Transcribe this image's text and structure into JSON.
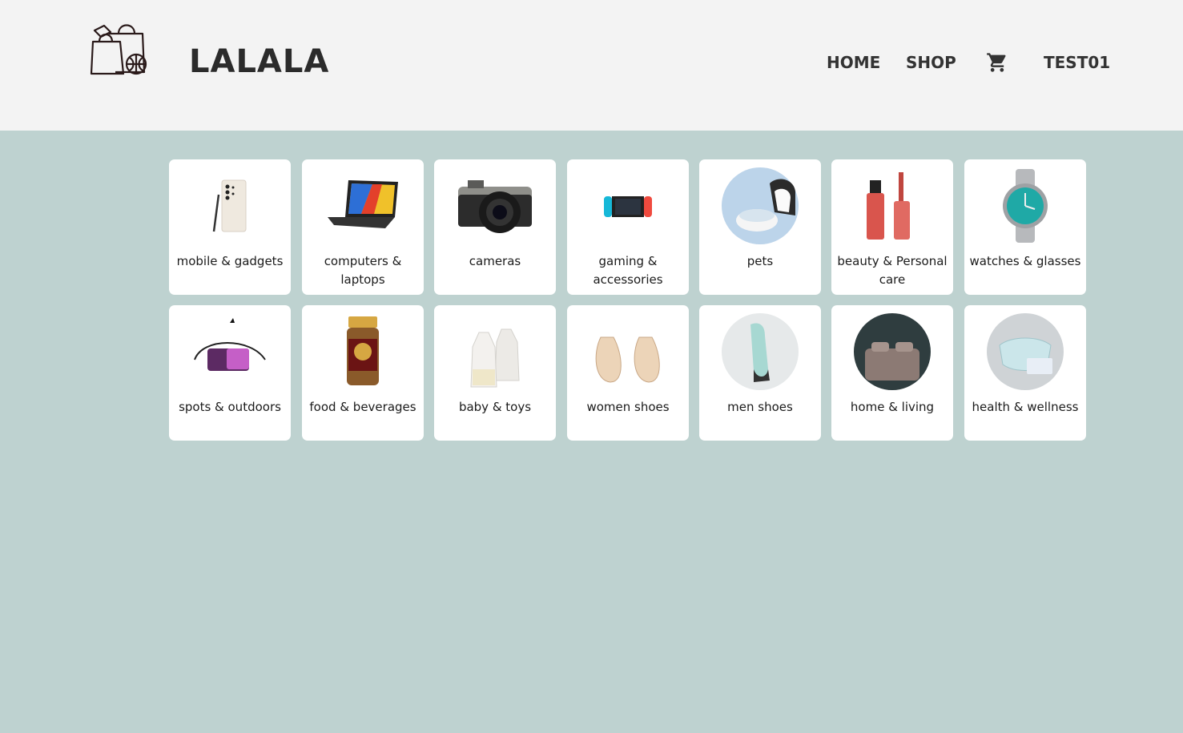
{
  "header": {
    "brand": "LALALA",
    "logo_icon": "shopping-bags-globe-icon",
    "nav": {
      "home": "HOME",
      "shop": "SHOP",
      "cart_icon": "cart-icon",
      "user": "TEST01"
    }
  },
  "colors": {
    "header_bg": "#f3f3f3",
    "page_bg": "#bed2d0",
    "card_bg": "#ffffff",
    "text": "#2b2b2b"
  },
  "categories": [
    {
      "label": "mobile & gadgets",
      "icon": "smartphone-icon"
    },
    {
      "label": "computers & laptops",
      "icon": "laptop-icon"
    },
    {
      "label": "cameras",
      "icon": "camera-icon"
    },
    {
      "label": "gaming & accessories",
      "icon": "game-console-icon"
    },
    {
      "label": "pets",
      "icon": "pet-fountain-icon"
    },
    {
      "label": "beauty & Personal care",
      "icon": "lip-gloss-icon"
    },
    {
      "label": "watches & glasses",
      "icon": "watch-icon"
    },
    {
      "label": "spots & outdoors",
      "icon": "sling-bag-icon"
    },
    {
      "label": "food & beverages",
      "icon": "coffee-jar-icon"
    },
    {
      "label": "baby & toys",
      "icon": "baby-bottle-icon"
    },
    {
      "label": "women shoes",
      "icon": "flat-shoes-icon"
    },
    {
      "label": "men shoes",
      "icon": "sneaker-icon"
    },
    {
      "label": "home & living",
      "icon": "bedroom-icon"
    },
    {
      "label": "health & wellness",
      "icon": "face-mask-icon"
    }
  ]
}
